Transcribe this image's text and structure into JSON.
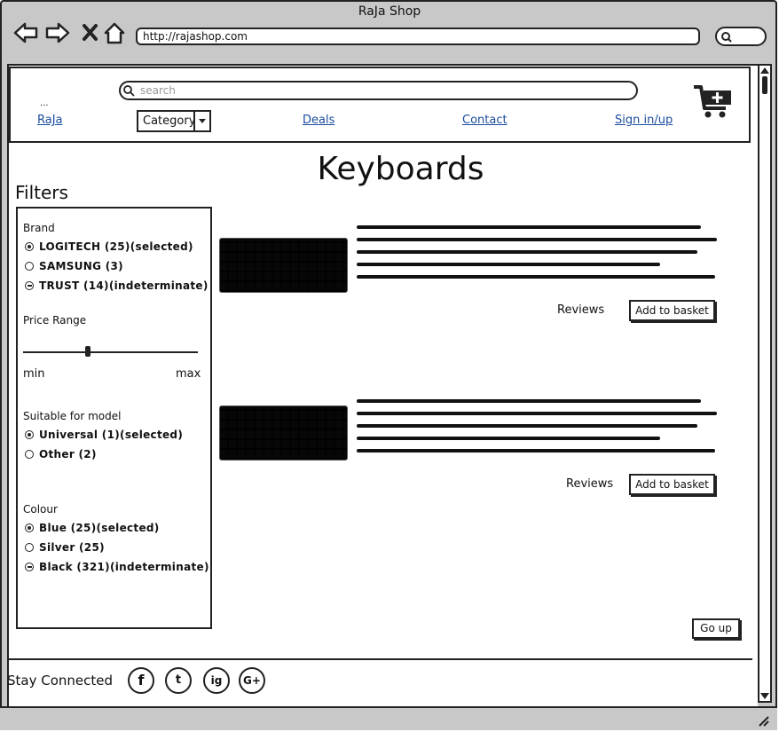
{
  "window": {
    "title": "RaJa Shop",
    "url": "http://rajashop.com"
  },
  "header": {
    "search_placeholder": "search",
    "logo_dots": "...",
    "nav": {
      "home": "RaJa",
      "category": "Category",
      "deals": "Deals",
      "contact": "Contact",
      "signin": "Sign in/up"
    }
  },
  "page": {
    "title": "Keyboards",
    "filters_title": "Filters"
  },
  "filters": {
    "brand": {
      "title": "Brand",
      "options": [
        {
          "label": "LOGITECH (25)(selected)",
          "state": "selected"
        },
        {
          "label": "SAMSUNG (3)",
          "state": "unselected"
        },
        {
          "label": "TRUST (14)(indeterminate)",
          "state": "indeterminate"
        }
      ]
    },
    "price": {
      "title": "Price Range",
      "min_label": "min",
      "max_label": "max",
      "value_fraction": 0.37
    },
    "model": {
      "title": "Suitable for model",
      "options": [
        {
          "label": "Universal (1)(selected)",
          "state": "selected"
        },
        {
          "label": "Other (2)",
          "state": "unselected"
        }
      ]
    },
    "colour": {
      "title": "Colour",
      "options": [
        {
          "label": "Blue (25)(selected)",
          "state": "selected"
        },
        {
          "label": "Silver (25)",
          "state": "unselected"
        },
        {
          "label": "Black (321)(indeterminate)",
          "state": "indeterminate"
        }
      ]
    }
  },
  "products": [
    {
      "reviews_label": "Reviews",
      "basket_label": "Add to basket"
    },
    {
      "reviews_label": "Reviews",
      "basket_label": "Add to basket"
    }
  ],
  "go_up_label": "Go up",
  "footer": {
    "stay_connected": "Stay Connected",
    "social": [
      "f",
      "t",
      "ig",
      "G+"
    ]
  }
}
